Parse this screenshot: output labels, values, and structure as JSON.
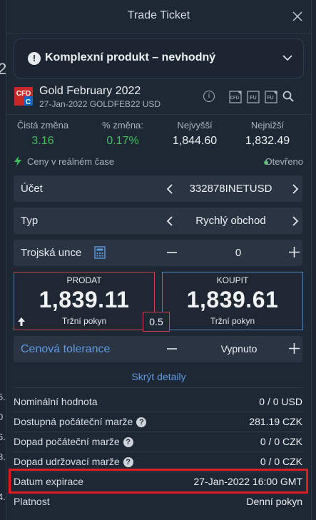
{
  "window": {
    "title": "Trade Ticket"
  },
  "warning": {
    "text": "Komplexní produkt – nevhodný"
  },
  "instrument": {
    "name": "Gold February 2022",
    "subtitle": "27-Jan-2022 GOLDFEB22 USD",
    "logo_text": "CFD",
    "logo_letter": "C",
    "tool_icons": [
      "info-icon",
      "cfd-document-icon",
      "fu-document-icon",
      "fu-document-icon-2",
      "search-icon"
    ],
    "tool_labels": [
      "CFD",
      "FU",
      "FU"
    ]
  },
  "stats": [
    {
      "label": "Čistá změna",
      "value": "3.16",
      "color": "#3fbe5a"
    },
    {
      "label": "% změna:",
      "value": "0.17%",
      "color": "#3fbe5a"
    },
    {
      "label": "Nejvyšší",
      "value": "1,844.60",
      "color": "#eef1f4"
    },
    {
      "label": "Nejnižší",
      "value": "1,832.49",
      "color": "#eef1f4"
    }
  ],
  "status": {
    "realtime": "Ceny v reálném čase",
    "market": "Otevřeno"
  },
  "account": {
    "label": "Účet",
    "value": "332878INETUSD"
  },
  "type": {
    "label": "Typ",
    "value": "Rychlý obchod"
  },
  "quantity": {
    "label": "Trojská unce",
    "value": "0"
  },
  "sell": {
    "label": "PRODAT",
    "price": "1,839.11",
    "order_type": "Tržní pokyn"
  },
  "buy": {
    "label": "KOUPIT",
    "price": "1,839.61",
    "order_type": "Tržní pokyn"
  },
  "spread": "0.5",
  "tolerance": {
    "label": "Cenová tolerance",
    "value": "Vypnuto"
  },
  "hide_details": "Skrýt detaily",
  "details": [
    {
      "label": "Nominální hodnota",
      "value": "0 / 0 USD",
      "help": false
    },
    {
      "label": "Dostupná počáteční marže",
      "value": "281.19 CZK",
      "help": true
    },
    {
      "label": "Dopad počáteční marže",
      "value": "0 / 0 CZK",
      "help": true
    },
    {
      "label": "Dopad udržovací marže",
      "value": "0 / 0 CZK",
      "help": true
    },
    {
      "label": "Datum expirace",
      "value": "27-Jan-2022 16:00 GMT",
      "help": false
    },
    {
      "label": "Platnost",
      "value": "Denní pokyn",
      "help": false
    }
  ],
  "background_fragments": [
    "20",
    "5.",
    "0",
    "6.",
    "8.",
    "4."
  ],
  "colors": {
    "accent": "#5e9ae0",
    "positive": "#3fbe5a",
    "sell_border": "#d0454a",
    "buy_border": "#4f86c6",
    "highlight": "#e01b24"
  }
}
